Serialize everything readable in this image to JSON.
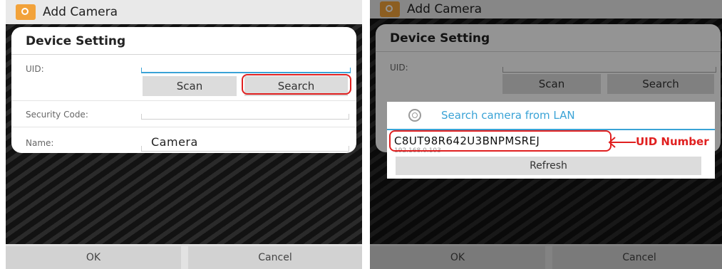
{
  "app": {
    "title": "Add Camera"
  },
  "dialog": {
    "title": "Device Setting",
    "uid_label": "UID:",
    "scan_label": "Scan",
    "search_label": "Search",
    "security_label": "Security Code:",
    "name_label": "Name:",
    "name_value": "Camera"
  },
  "footer": {
    "ok_label": "OK",
    "cancel_label": "Cancel"
  },
  "popup": {
    "title": "Search camera from LAN",
    "uid_value": "C8UT98R642U3BNPMSREJ",
    "ip_value": "192.168.0.103",
    "refresh_label": "Refresh"
  },
  "annotation": {
    "label": "UID Number",
    "color": "#e02020"
  },
  "icons": {
    "app": "camera-app-icon",
    "popup": "search-lan-icon"
  },
  "colors": {
    "accent": "#3aa3d6",
    "highlight": "#e02020"
  }
}
